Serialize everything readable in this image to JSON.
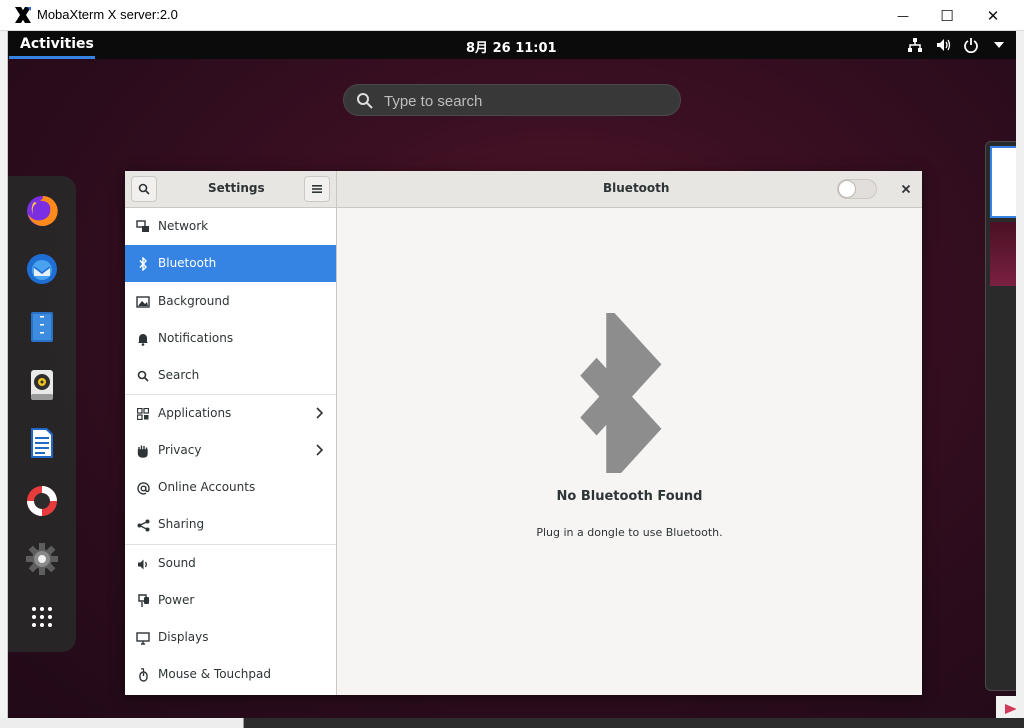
{
  "window": {
    "title": "MobaXterm X server:2.0",
    "min_glyph": "—",
    "max_glyph": "☐",
    "close_glyph": "✕"
  },
  "topbar": {
    "activities": "Activities",
    "clock": "8月 26  11:01"
  },
  "overview": {
    "search_placeholder": "Type to search"
  },
  "dash": {
    "items": [
      "firefox-icon",
      "thunderbird-icon",
      "files-icon",
      "rhythmbox-icon",
      "writer-icon",
      "help-icon",
      "settings-icon",
      "show-apps-icon"
    ]
  },
  "settings": {
    "title": "Settings",
    "panel_title": "Bluetooth",
    "sidebar": {
      "items": [
        {
          "label": "Network",
          "icon": "network-icon"
        },
        {
          "label": "Bluetooth",
          "icon": "bluetooth-icon"
        },
        {
          "label": "Background",
          "icon": "background-icon"
        },
        {
          "label": "Notifications",
          "icon": "bell-icon"
        },
        {
          "label": "Search",
          "icon": "search-icon"
        },
        {
          "label": "Applications",
          "icon": "apps-grid-icon"
        },
        {
          "label": "Privacy",
          "icon": "hand-icon"
        },
        {
          "label": "Online Accounts",
          "icon": "at-icon"
        },
        {
          "label": "Sharing",
          "icon": "share-icon"
        },
        {
          "label": "Sound",
          "icon": "speaker-icon"
        },
        {
          "label": "Power",
          "icon": "power-plug-icon"
        },
        {
          "label": "Displays",
          "icon": "display-icon"
        },
        {
          "label": "Mouse & Touchpad",
          "icon": "mouse-icon"
        }
      ],
      "selected": "Bluetooth"
    },
    "bluetooth": {
      "enabled": false,
      "empty_title": "No Bluetooth Found",
      "empty_desc": "Plug in a dongle to use Bluetooth."
    }
  },
  "colors": {
    "accent": "#3584e4",
    "topbar": "#0b0b0b",
    "desktop": "#3b0f22"
  }
}
